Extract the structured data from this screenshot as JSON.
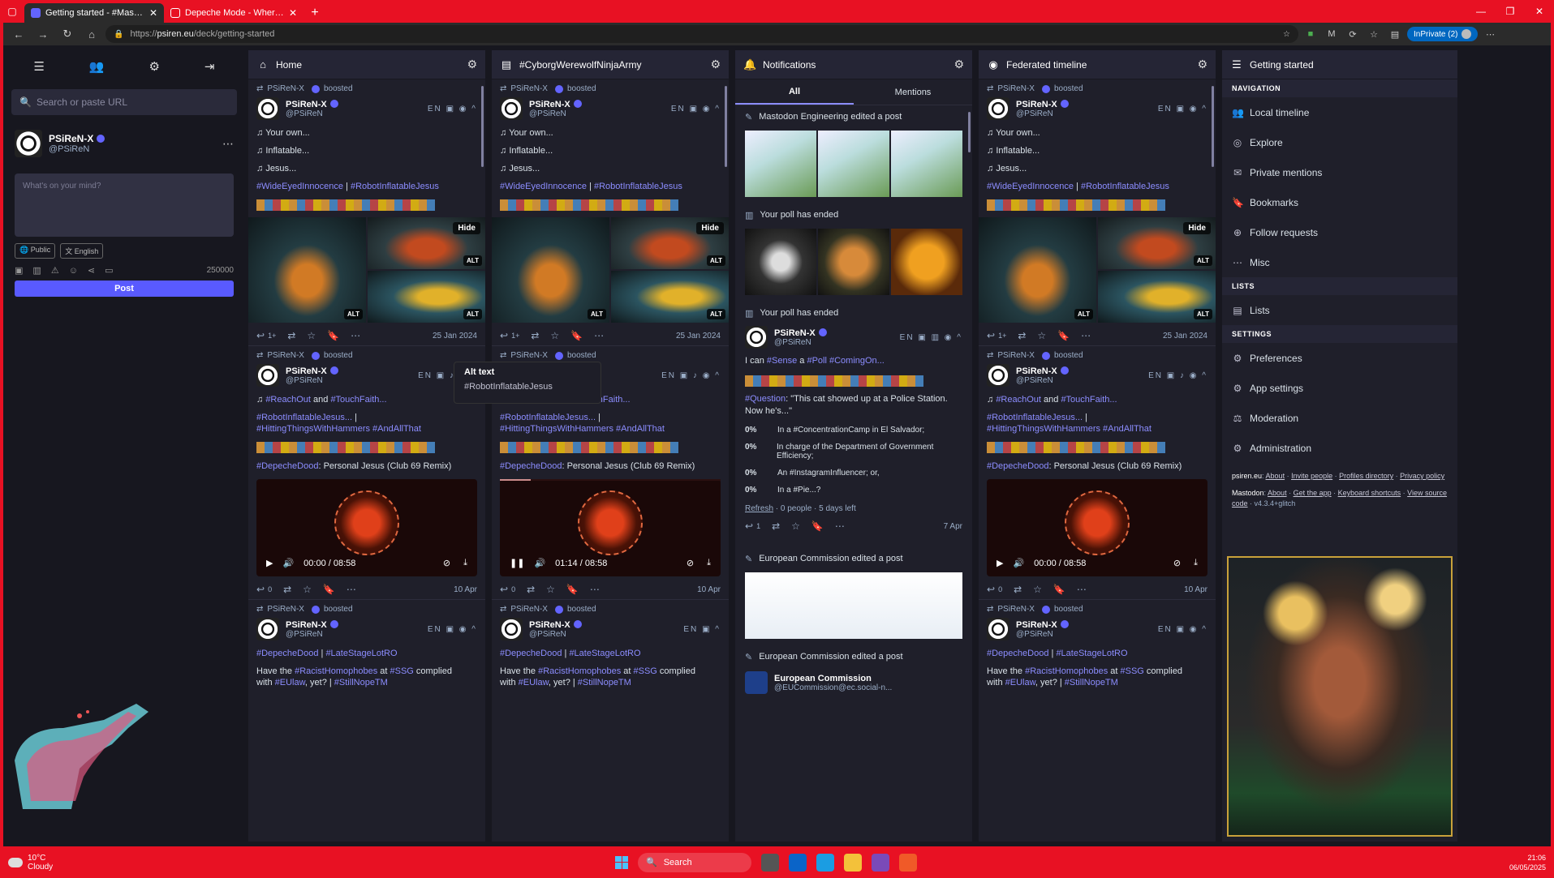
{
  "browser": {
    "tabs": [
      {
        "title": "Getting started - #Mastodon",
        "active": true
      },
      {
        "title": "Depeche Mode - Where's The Revolution",
        "active": false
      }
    ],
    "url_prefix": "https://",
    "url_host": "psiren.eu",
    "url_path": "/deck/getting-started",
    "inprivate_label": "InPrivate (2)"
  },
  "nav": {
    "search_placeholder": "Search or paste URL",
    "user": {
      "name": "PSiReN-X",
      "handle": "@PSiReN"
    },
    "compose_placeholder": "What's on your mind?",
    "visibility": "Public",
    "language": "English",
    "char_count": "250000",
    "post_label": "Post"
  },
  "columns": {
    "home": "Home",
    "hashtag": "#CyborgWerewolfNinjaArmy",
    "notifications": "Notifications",
    "federated": "Federated timeline",
    "getting_started": "Getting started"
  },
  "post1": {
    "boosted_label": "boosted",
    "name": "PSiReN-X",
    "handle": "@PSiReN",
    "lang": "EN",
    "lines": [
      "Your own...",
      "Inflatable...",
      "Jesus..."
    ],
    "tags_a": "#WideEyedInnocence",
    "sep": " | ",
    "tags_b": "#RobotInflatableJesus",
    "hide_label": "Hide",
    "alt_label": "ALT",
    "replies": "1+",
    "date": "25 Jan 2024"
  },
  "post2": {
    "line1_tag_a": "#ReachOut",
    "line1_and": " and ",
    "line1_tag_b": "#TouchFaith...",
    "line2_tag": "#RobotInflatableJesus...",
    "line2_rest": " |",
    "line3_tag_a": "#HittingThingsWithHammers",
    "line3_tag_b": "#AndAllThat",
    "song_tag": "#DepecheDood",
    "song_title": ": Personal Jesus (Club 69 Remix)",
    "time_start": "00:00",
    "time_mid": "01:14",
    "duration": "08:58",
    "progress_hashtag_col": 0.138,
    "replies": "0",
    "date": "10 Apr"
  },
  "post3": {
    "tag_a": "#DepecheDood",
    "tag_b": "#LateStageLotRO",
    "l_have": "Have the ",
    "l_tag1": "#RacistHomophobes",
    "l_at": " at ",
    "l_tag2": "#SSG",
    "l_complied": " complied",
    "l_with": "with ",
    "l_tag3": "#EUlaw",
    "l_yet": ", yet? | ",
    "l_tag4": "#StillNopeTM"
  },
  "tooltip": {
    "title": "Alt text",
    "body": "#RobotInflatableJesus"
  },
  "notifications": {
    "tabs": [
      "All",
      "Mentions"
    ],
    "n1": "Mastodon Engineering edited a post",
    "n2": "Your poll has ended",
    "n3": "Your poll has ended",
    "poll_text_a": "I can ",
    "poll_tag1": "#Sense",
    "poll_text_b": " a ",
    "poll_tag2": "#Poll",
    "poll_tag3": "#ComingOn...",
    "question_tag": "#Question",
    "question_text": ": \"This cat showed up at a Police Station. Now he's...\"",
    "options": [
      {
        "pct": "0%",
        "text": "In a #ConcentrationCamp in El Salvador;"
      },
      {
        "pct": "0%",
        "text": "In charge of the Department of Government Efficiency;"
      },
      {
        "pct": "0%",
        "text": "An #InstagramInfluencer; or,"
      },
      {
        "pct": "0%",
        "text": "In a #Pie...?"
      }
    ],
    "refresh": "Refresh",
    "poll_meta": " · 0 people · 5 days left",
    "poll_replies": "1",
    "poll_date": "7 Apr",
    "n4": "European Commission edited a post",
    "n5": "European Commission edited a post",
    "ec_name": "European Commission",
    "ec_handle": "@EUCommission@ec.social-n..."
  },
  "getting_started": {
    "nav_section": "NAVIGATION",
    "nav_items": [
      "Local timeline",
      "Explore",
      "Private mentions",
      "Bookmarks",
      "Follow requests",
      "Misc"
    ],
    "lists_section": "LISTS",
    "lists_item": "Lists",
    "settings_section": "SETTINGS",
    "settings_items": [
      "Preferences",
      "App settings",
      "Moderation",
      "Administration"
    ],
    "footer_host": "psiren.eu",
    "footer_links": [
      "About",
      "Invite people",
      "Profiles directory",
      "Privacy policy"
    ],
    "mastodon_label": "Mastodon",
    "mastodon_links": [
      "About",
      "Get the app",
      "Keyboard shortcuts",
      "View source code"
    ],
    "version": "v4.3.4+glitch"
  },
  "taskbar": {
    "temp": "10°C",
    "weather": "Cloudy",
    "search": "Search",
    "time": "21:06",
    "date": "06/05/2025"
  },
  "colors": {
    "accent": "#6364ff",
    "hashtag": "#8c8dff",
    "chrome": "#e81123"
  }
}
